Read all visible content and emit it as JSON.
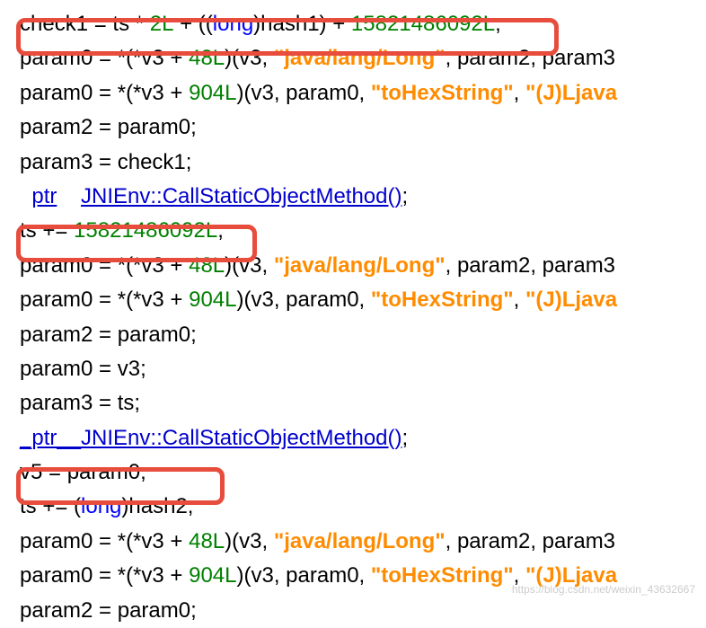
{
  "header_fragment": "",
  "lines": {
    "l1": {
      "p1": "check1 = ts * ",
      "n1": "2L",
      "p2": " + ((",
      "t1": "long",
      "p3": ")hash1) + ",
      "n2": "15821486092L",
      "p4": ";"
    },
    "l2": {
      "p1": "param0 = *(*v3 + ",
      "n1": "48L",
      "p2": ")(v3, ",
      "s1": "\"java/lang/Long\"",
      "p3": ", param2, param3"
    },
    "l3": {
      "p1": "param0 = *(*v3 + ",
      "n1": "904L",
      "p2": ")(v3, param0, ",
      "s1": "\"toHexString\"",
      "p3": ", ",
      "s2": "\"(J)Ljava"
    },
    "l4": {
      "p1": "param2 = param0;"
    },
    "l5": {
      "p1": "param3 = check1;"
    },
    "l6": {
      "link1": "ptr",
      "sp": "    ",
      "link2": "JNIEnv::CallStaticObjectMethod()",
      "p1": ";"
    },
    "l7": {
      "p1": "ts += ",
      "n1": "15821486092L",
      "p2": ";"
    },
    "l8": {
      "p1": "param0 = *(*v3 + ",
      "n1": "48L",
      "p2": ")(v3, ",
      "s1": "\"java/lang/Long\"",
      "p3": ", param2, param3"
    },
    "l9": {
      "p1": "param0 = *(*v3 + ",
      "n1": "904L",
      "p2": ")(v3, param0, ",
      "s1": "\"toHexString\"",
      "p3": ", ",
      "s2": "\"(J)Ljava"
    },
    "l10": {
      "p1": "param2 = param0;"
    },
    "l11": {
      "p1": "param0 = v3;"
    },
    "l12": {
      "p1": "param3 = ts;"
    },
    "l13": {
      "link1": "_ptr__JNIEnv::CallStaticObjectMethod()",
      "p1": ";"
    },
    "l14": {
      "p1": "v5 = param0;"
    },
    "l15": {
      "p1": "ts += (",
      "t1": "long",
      "p2": ")hash2;"
    },
    "l16": {
      "p1": "param0 = *(*v3 + ",
      "n1": "48L",
      "p2": ")(v3, ",
      "s1": "\"java/lang/Long\"",
      "p3": ", param2, param3"
    },
    "l17": {
      "p1": "param0 = *(*v3 + ",
      "n1": "904L",
      "p2": ")(v3, param0, ",
      "s1": "\"toHexString\"",
      "p3": ", ",
      "s2": "\"(J)Ljava"
    },
    "l18": {
      "p1": "param2 = param0;"
    }
  },
  "watermark": "https://blog.csdn.net/weixin_43632667"
}
